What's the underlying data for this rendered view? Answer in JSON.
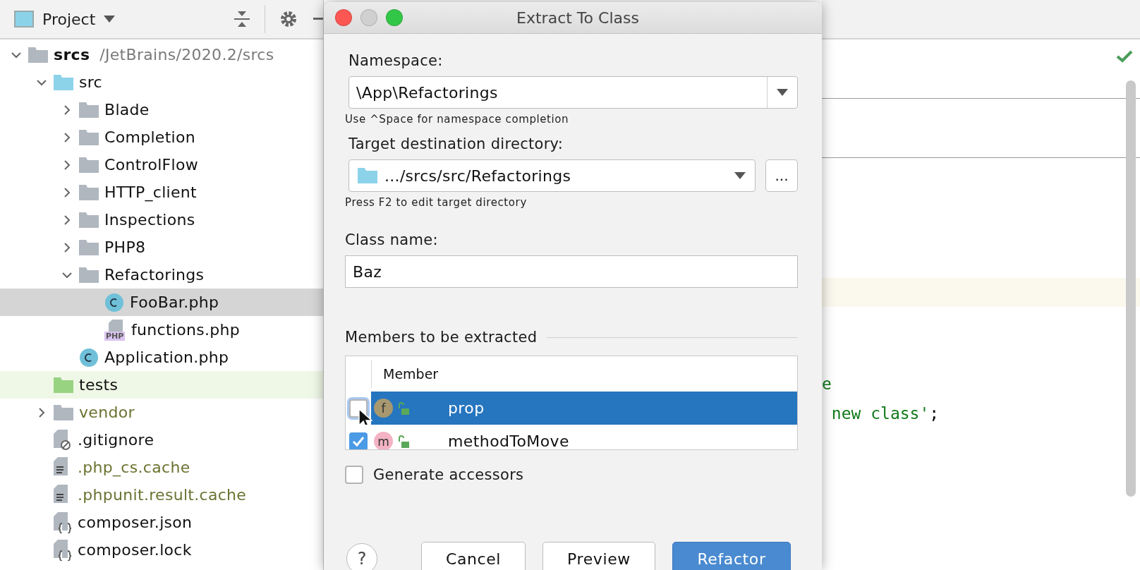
{
  "project_panel": {
    "title": "Project",
    "tree": [
      {
        "label": "srcs",
        "path": "/JetBrains/2020.2/srcs",
        "kind": "root",
        "expanded": true,
        "selected": false,
        "ignored": false,
        "children": [
          {
            "label": "src",
            "kind": "source-folder",
            "expanded": true,
            "selected": false,
            "ignored": false,
            "children": [
              {
                "label": "Blade",
                "kind": "folder",
                "expanded": false,
                "selected": false,
                "ignored": false
              },
              {
                "label": "Completion",
                "kind": "folder",
                "expanded": false,
                "selected": false,
                "ignored": false
              },
              {
                "label": "ControlFlow",
                "kind": "folder",
                "expanded": false,
                "selected": false,
                "ignored": false
              },
              {
                "label": "HTTP_client",
                "kind": "folder",
                "expanded": false,
                "selected": false,
                "ignored": false
              },
              {
                "label": "Inspections",
                "kind": "folder",
                "expanded": false,
                "selected": false,
                "ignored": false
              },
              {
                "label": "PHP8",
                "kind": "folder",
                "expanded": false,
                "selected": false,
                "ignored": false
              },
              {
                "label": "Refactorings",
                "kind": "folder",
                "expanded": true,
                "selected": false,
                "ignored": false,
                "children": [
                  {
                    "label": "FooBar.php",
                    "kind": "class",
                    "selected": true,
                    "ignored": false
                  },
                  {
                    "label": "functions.php",
                    "kind": "php",
                    "badge": "PHP",
                    "selected": false,
                    "ignored": false
                  }
                ]
              },
              {
                "label": "Application.php",
                "kind": "class",
                "selected": false,
                "ignored": false
              }
            ]
          },
          {
            "label": "tests",
            "kind": "test-folder",
            "selected": false,
            "ignored": false
          },
          {
            "label": "vendor",
            "kind": "folder",
            "expanded": false,
            "selected": false,
            "ignored": true
          },
          {
            "label": ".gitignore",
            "kind": "ignore-file",
            "selected": false,
            "ignored": false
          },
          {
            "label": ".php_cs.cache",
            "kind": "text-file",
            "selected": false,
            "ignored": true
          },
          {
            "label": ".phpunit.result.cache",
            "kind": "text-file",
            "selected": false,
            "ignored": true
          },
          {
            "label": "composer.json",
            "kind": "json-file",
            "selected": false,
            "ignored": false
          },
          {
            "label": "composer.lock",
            "kind": "json-file",
            "selected": false,
            "ignored": false
          }
        ]
      }
    ]
  },
  "dialog": {
    "title": "Extract To Class",
    "namespace": {
      "label": "Namespace:",
      "value": "\\App\\Refactorings",
      "hint": "Use ^Space for namespace completion"
    },
    "directory": {
      "label": "Target destination directory:",
      "value": ".../srcs/src/Refactorings",
      "browse": "...",
      "hint": "Press F2 to edit target directory"
    },
    "class_name": {
      "label": "Class name:",
      "value": "Baz"
    },
    "members": {
      "title": "Members to be extracted",
      "column": "Member",
      "rows": [
        {
          "name": "prop",
          "icon": "f",
          "kind": "field",
          "checked": false,
          "selected": true
        },
        {
          "name": "methodToMove",
          "icon": "m",
          "kind": "method",
          "checked": true,
          "selected": false
        }
      ]
    },
    "generate_accessors": {
      "label": "Generate accessors",
      "checked": false
    },
    "help": "?",
    "buttons": [
      {
        "label": "Cancel",
        "primary": false
      },
      {
        "label": "Preview",
        "primary": false
      },
      {
        "label": "Refactor",
        "primary": true
      }
    ]
  },
  "editor": {
    "code_lines": [
      [
        {
          "text": "e",
          "kind": "string"
        }
      ],
      [
        {
          "text": " new class'",
          "kind": "string"
        },
        {
          "text": ";",
          "kind": "plain"
        }
      ]
    ]
  }
}
